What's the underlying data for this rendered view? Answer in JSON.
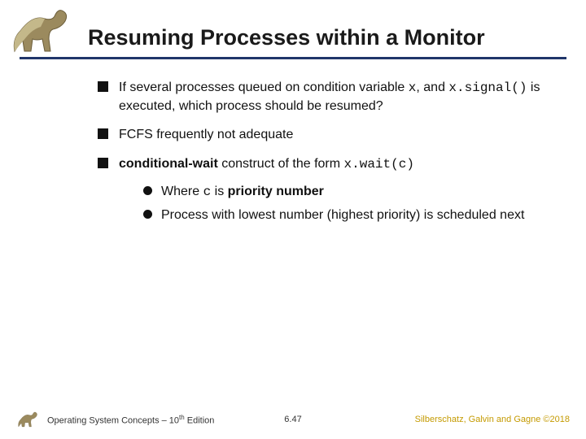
{
  "title": "Resuming Processes within a Monitor",
  "bullets": {
    "b1a_pre": "If several processes queued on condition variable ",
    "b1a_code1": "x",
    "b1a_mid": ", and ",
    "b1a_code2": "x.signal()",
    "b1a_post": " is executed, which process should be resumed?",
    "b2": "FCFS frequently not adequate",
    "b3_strong": "conditional-wait",
    "b3_mid": " construct of the form ",
    "b3_code": "x.wait(c)",
    "s1_pre": "Where ",
    "s1_code": "c",
    "s1_post": " is ",
    "s1_strong": "priority number",
    "s2": "Process with lowest number (highest priority) is scheduled next"
  },
  "footer": {
    "left_pre": "Operating System Concepts – 10",
    "left_sup": "th",
    "left_post": " Edition",
    "center": "6.47",
    "right": "Silberschatz, Galvin and Gagne ©2018"
  }
}
